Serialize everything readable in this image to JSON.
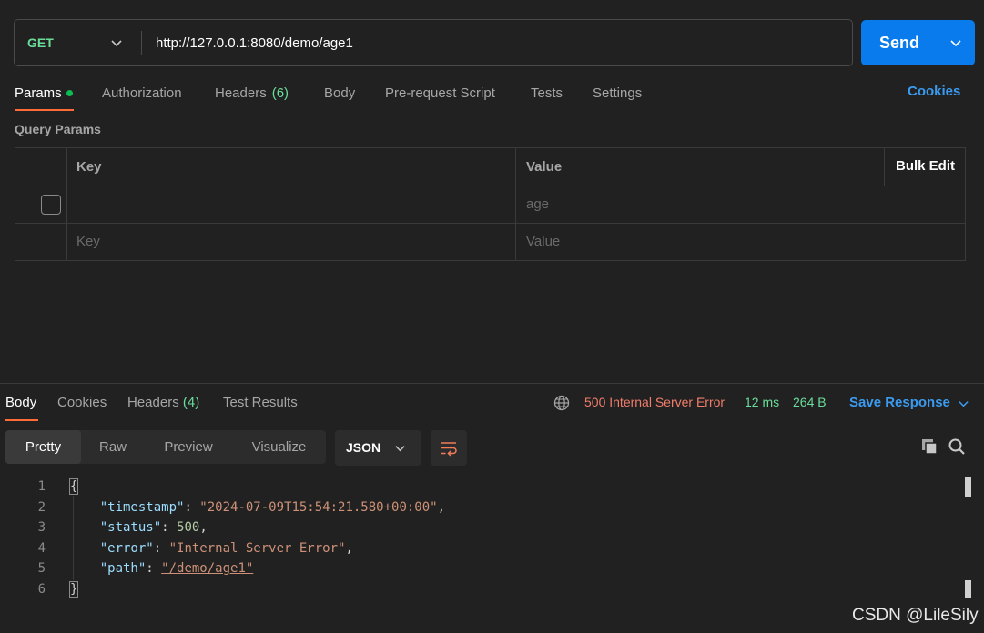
{
  "request": {
    "method": "GET",
    "url": "http://127.0.0.1:8080/demo/age1",
    "send_label": "Send"
  },
  "request_tabs": {
    "params": "Params",
    "authorization": "Authorization",
    "headers": "Headers",
    "headers_count": "(6)",
    "body": "Body",
    "pre_request": "Pre-request Script",
    "tests": "Tests",
    "settings": "Settings",
    "cookies": "Cookies"
  },
  "query_params": {
    "title": "Query Params",
    "col_key": "Key",
    "col_value": "Value",
    "bulk_edit": "Bulk Edit",
    "rows": [
      {
        "key": "",
        "value_placeholder": "age"
      }
    ],
    "new_key_placeholder": "Key",
    "new_value_placeholder": "Value"
  },
  "response_tabs": {
    "body": "Body",
    "cookies": "Cookies",
    "headers": "Headers",
    "headers_count": "(4)",
    "test_results": "Test Results"
  },
  "response_status": {
    "status": "500 Internal Server Error",
    "time": "12 ms",
    "size": "264 B",
    "save_response": "Save Response"
  },
  "format_toolbar": {
    "pretty": "Pretty",
    "raw": "Raw",
    "preview": "Preview",
    "visualize": "Visualize",
    "language": "JSON"
  },
  "response_body": {
    "line_numbers": [
      "1",
      "2",
      "3",
      "4",
      "5",
      "6"
    ],
    "open_brace": "{",
    "close_brace": "}",
    "timestamp_key": "\"timestamp\"",
    "timestamp_value": "\"2024-07-09T15:54:21.580+00:00\"",
    "status_key": "\"status\"",
    "status_value": "500",
    "error_key": "\"error\"",
    "error_value": "\"Internal Server Error\"",
    "path_key": "\"path\"",
    "path_value": "\"/demo/age1\""
  },
  "watermark": "CSDN @LileSily",
  "colors": {
    "accent_blue": "#097bed",
    "active_tab": "#ff6c37",
    "method_green": "#6bdd9a",
    "error_red": "#f27d6b"
  }
}
